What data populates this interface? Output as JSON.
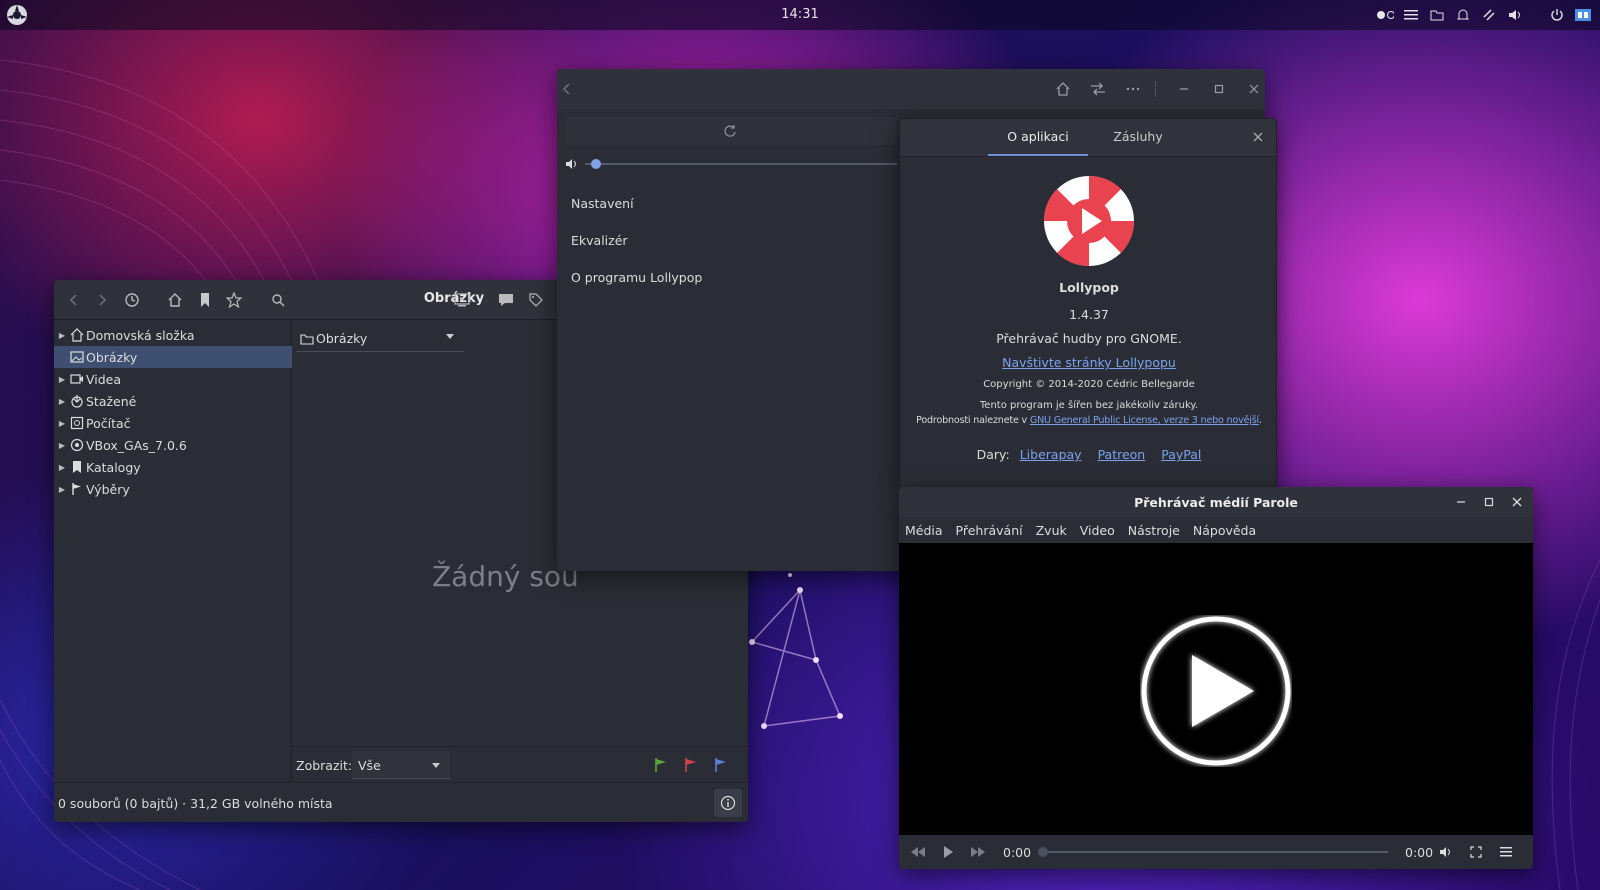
{
  "top_panel": {
    "clock": "14:31",
    "tray_icons": [
      "workspace-switcher-icon",
      "menu-icon",
      "files-icon",
      "notification-icon",
      "network-icon",
      "volume-icon",
      "power-icon",
      "keyboard-layout-icon"
    ]
  },
  "file_manager": {
    "title": "Obrázky",
    "tree": [
      {
        "label": "Domovská složka",
        "icon": "home-icon",
        "selected": false
      },
      {
        "label": "Obrázky",
        "icon": "images-icon",
        "selected": true
      },
      {
        "label": "Videa",
        "icon": "video-icon",
        "selected": false
      },
      {
        "label": "Stažené",
        "icon": "download-icon",
        "selected": false
      },
      {
        "label": "Počítač",
        "icon": "computer-icon",
        "selected": false
      },
      {
        "label": "VBox_GAs_7.0.6",
        "icon": "disc-icon",
        "selected": false
      },
      {
        "label": "Katalogy",
        "icon": "bookmark-icon",
        "selected": false
      },
      {
        "label": "Výběry",
        "icon": "flag-icon",
        "selected": false
      }
    ],
    "location": "Obrázky",
    "empty_message": "Žádný sou",
    "filter_label": "Zobrazit:",
    "filter_value": "Vše",
    "status": "0 souborů (0 bajtů)  ·  31,2 GB volného místa",
    "flag_colors": {
      "green": "#5aa33a",
      "red": "#d0424a",
      "blue": "#5d7fd0"
    }
  },
  "lollypop": {
    "menu": [
      "Nastavení",
      "Ekvalizér",
      "O programu Lollypop"
    ],
    "volume_fraction": 0.02,
    "accent": "#7fa3e6"
  },
  "about": {
    "tabs": [
      "O aplikaci",
      "Zásluhy"
    ],
    "app_name": "Lollypop",
    "version": "1.4.37",
    "description": "Přehrávač hudby pro GNOME.",
    "website_link": "Navštivte stránky Lollypopu",
    "copyright": "Copyright © 2014-2020 Cédric Bellegarde",
    "warranty": "Tento program je šířen bez jakékoliv záruky.",
    "license_prefix": "Podrobnosti naleznete v ",
    "license_link": "GNU General Public License, verze 3 nebo novější",
    "license_suffix": ".",
    "donations_label": "Dary:",
    "donations": [
      "Liberapay",
      "Patreon",
      "PayPal"
    ],
    "logo_colors": {
      "red": "#e8434f",
      "white": "#ffffff"
    }
  },
  "parole": {
    "title": "Přehrávač médií Parole",
    "menu": [
      "Média",
      "Přehrávání",
      "Zvuk",
      "Video",
      "Nástroje",
      "Nápověda"
    ],
    "time_current": "0:00",
    "time_total": "0:00",
    "progress_fraction": 0
  }
}
